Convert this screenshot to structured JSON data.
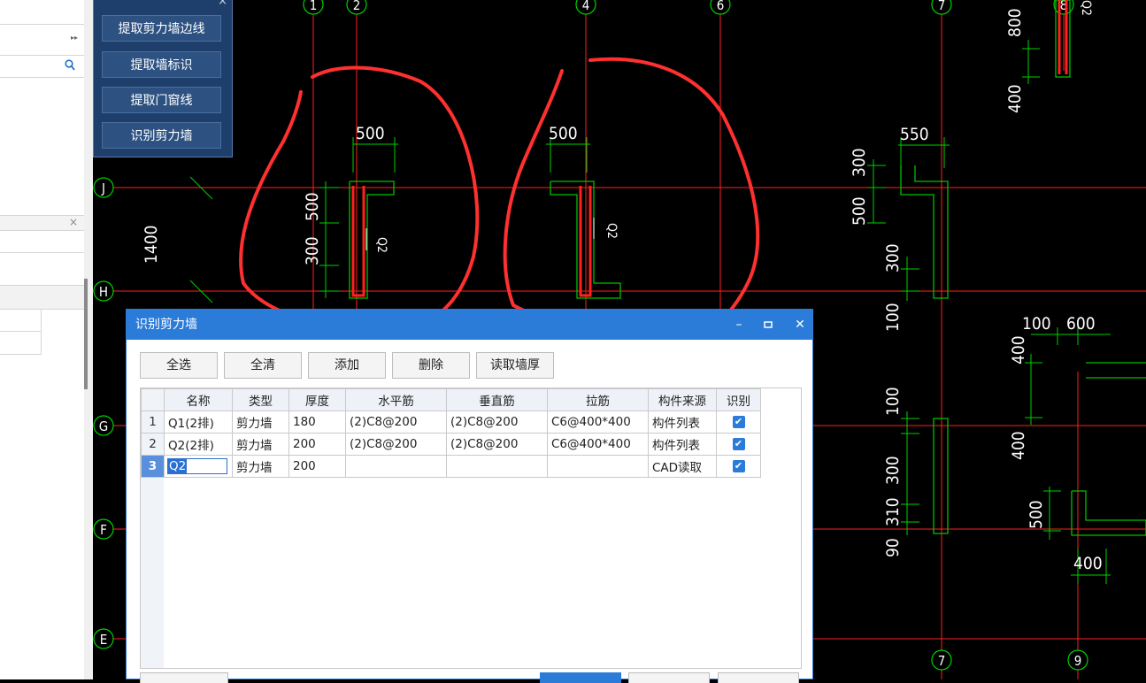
{
  "tool_panel": {
    "close": "×",
    "buttons": [
      "提取剪力墙边线",
      "提取墙标识",
      "提取门窗线",
      "识别剪力墙"
    ]
  },
  "left_panel": {
    "collapse_glyph": "▸▸",
    "search_icon": "search-icon",
    "close": "×"
  },
  "cad": {
    "axis_top": [
      "1",
      "2",
      "4",
      "6",
      "7",
      "8"
    ],
    "axis_bottom": [
      "7",
      "9"
    ],
    "axis_left": [
      "J",
      "H",
      "G",
      "F",
      "E"
    ],
    "dims": [
      "500",
      "500",
      "550",
      "500",
      "300",
      "1400",
      "300",
      "500",
      "300",
      "800",
      "400",
      "100",
      "100",
      "600",
      "400",
      "100",
      "300",
      "400",
      "310",
      "90",
      "500",
      "400"
    ],
    "wall_labels": [
      "Q2",
      "Q2",
      "Q2"
    ]
  },
  "dialog": {
    "title": "识别剪力墙",
    "controls": [
      "–",
      "▫",
      "✕"
    ],
    "buttons": [
      "全选",
      "全清",
      "添加",
      "删除",
      "读取墙厚"
    ],
    "columns": [
      "名称",
      "类型",
      "厚度",
      "水平筋",
      "垂直筋",
      "拉筋",
      "构件来源",
      "识别"
    ],
    "rows": [
      {
        "num": "1",
        "name": "Q1(2排)",
        "type": "剪力墙",
        "thickness": "180",
        "horizontal": "(2)C8@200",
        "vertical": "(2)C8@200",
        "tie": "C6@400*400",
        "source": "构件列表",
        "recognize": "✔"
      },
      {
        "num": "2",
        "name": "Q2(2排)",
        "type": "剪力墙",
        "thickness": "200",
        "horizontal": "(2)C8@200",
        "vertical": "(2)C8@200",
        "tie": "C6@400*400",
        "source": "构件列表",
        "recognize": "✔"
      },
      {
        "num": "3",
        "name": "Q2",
        "type": "剪力墙",
        "thickness": "200",
        "horizontal": "",
        "vertical": "",
        "tie": "",
        "source": "CAD读取",
        "recognize": "✔"
      }
    ]
  },
  "colors": {
    "axis": "#ff2020",
    "wall": "#00c000",
    "dim": "#00d000",
    "annotation": "#ff3030",
    "title_bar": "#2b7bd8"
  }
}
